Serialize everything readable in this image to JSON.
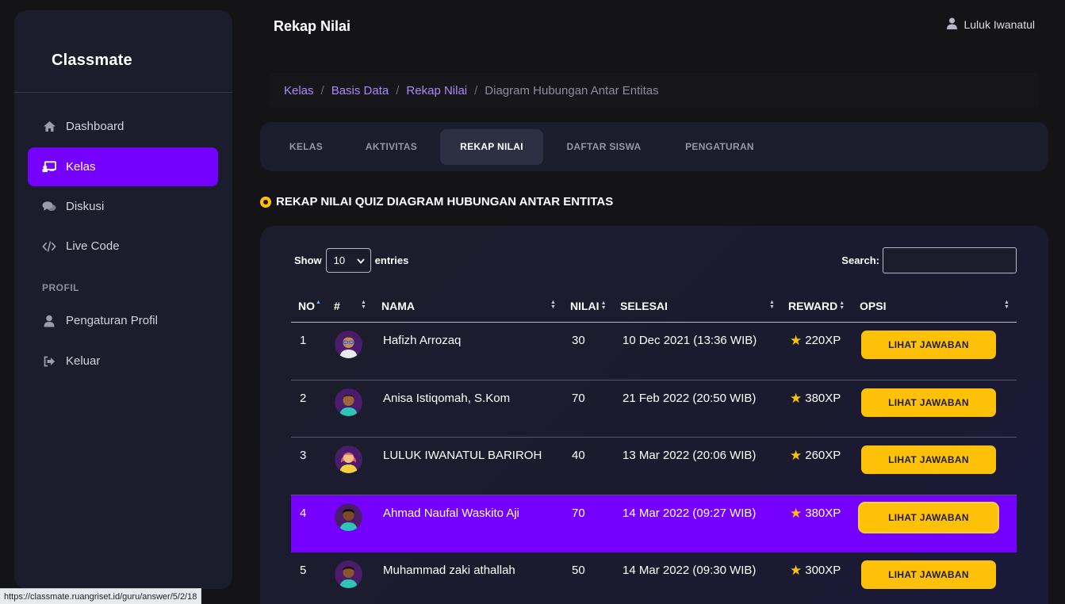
{
  "app": {
    "logo": "Classmate"
  },
  "header": {
    "title": "Rekap Nilai",
    "user_name": "Luluk Iwanatul"
  },
  "sidebar": {
    "items": [
      {
        "label": "Dashboard",
        "icon": "home-icon",
        "active": false
      },
      {
        "label": "Kelas",
        "icon": "chalkboard-icon",
        "active": true
      },
      {
        "label": "Diskusi",
        "icon": "comments-icon",
        "active": false
      },
      {
        "label": "Live Code",
        "icon": "code-icon",
        "active": false
      }
    ],
    "section_label": "PROFIL",
    "profile_items": [
      {
        "label": "Pengaturan Profil",
        "icon": "user-icon"
      },
      {
        "label": "Keluar",
        "icon": "sign-out-icon"
      }
    ]
  },
  "breadcrumb": {
    "links": [
      "Kelas",
      "Basis Data",
      "Rekap Nilai"
    ],
    "current": "Diagram Hubungan Antar Entitas",
    "separator": "/"
  },
  "tabs": [
    {
      "label": "KELAS",
      "active": false
    },
    {
      "label": "AKTIVITAS",
      "active": false
    },
    {
      "label": "REKAP NILAI",
      "active": true
    },
    {
      "label": "DAFTAR SISWA",
      "active": false
    },
    {
      "label": "PENGATURAN",
      "active": false
    }
  ],
  "section_heading": "REKAP NILAI QUIZ DIAGRAM HUBUNGAN ANTAR ENTITAS",
  "table_controls": {
    "show_label": "Show",
    "entries_value": "10",
    "entries_label": "entries",
    "search_label": "Search:",
    "search_value": ""
  },
  "table": {
    "columns": [
      "NO",
      "#",
      "NAMA",
      "NILAI",
      "SELESAI",
      "REWARD",
      "OPSI"
    ],
    "action_label": "LIHAT JAWABAN",
    "rows": [
      {
        "no": "1",
        "nama": "Hafizh Arrozaq",
        "nilai": "30",
        "selesai": "10 Dec 2021 (13:36 WIB)",
        "reward": "220XP",
        "highlight": false
      },
      {
        "no": "2",
        "nama": "Anisa Istiqomah, S.Kom",
        "nilai": "70",
        "selesai": "21 Feb 2022 (20:50 WIB)",
        "reward": "380XP",
        "highlight": false
      },
      {
        "no": "3",
        "nama": "LULUK IWANATUL BARIROH",
        "nilai": "40",
        "selesai": "13 Mar 2022 (20:06 WIB)",
        "reward": "260XP",
        "highlight": false
      },
      {
        "no": "4",
        "nama": "Ahmad Naufal Waskito Aji",
        "nilai": "70",
        "selesai": "14 Mar 2022 (09:27 WIB)",
        "reward": "380XP",
        "highlight": true
      },
      {
        "no": "5",
        "nama": "Muhammad zaki athallah",
        "nilai": "50",
        "selesai": "14 Mar 2022 (09:30 WIB)",
        "reward": "300XP",
        "highlight": false
      }
    ]
  },
  "status_bar": {
    "url": "https://classmate.ruangriset.id/guru/answer/5/2/18"
  },
  "colors": {
    "accent": "#7600ff",
    "button": "#ffc107",
    "panel": "#1c1d2c",
    "background": "#141416"
  }
}
